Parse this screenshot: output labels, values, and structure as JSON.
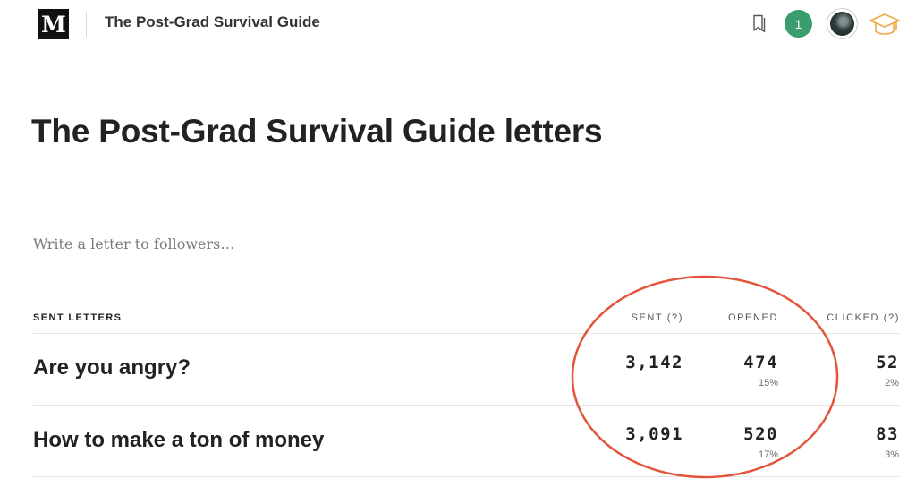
{
  "header": {
    "logo_letter": "M",
    "publication_name": "The Post-Grad Survival Guide",
    "notification_count": "1",
    "icons": {
      "bookmark": "bookmark-icon",
      "avatar": "avatar",
      "graduation": "graduation-cap-icon"
    },
    "colors": {
      "notification": "#3b9c6e",
      "graduation_icon": "#f0a845",
      "annotation": "#e2553a"
    }
  },
  "page_title": "The Post-Grad Survival Guide letters",
  "compose": {
    "placeholder": "Write a letter to followers…"
  },
  "table": {
    "headers": {
      "sent_letters": "SENT LETTERS",
      "sent": "SENT (?)",
      "opened": "OPENED",
      "clicked": "CLICKED (?)"
    },
    "rows": [
      {
        "title": "Are you angry?",
        "sent": "3,142",
        "opened": "474",
        "opened_pct": "15%",
        "clicked": "52",
        "clicked_pct": "2%"
      },
      {
        "title": "How to make a ton of money",
        "sent": "3,091",
        "opened": "520",
        "opened_pct": "17%",
        "clicked": "83",
        "clicked_pct": "3%"
      }
    ]
  }
}
